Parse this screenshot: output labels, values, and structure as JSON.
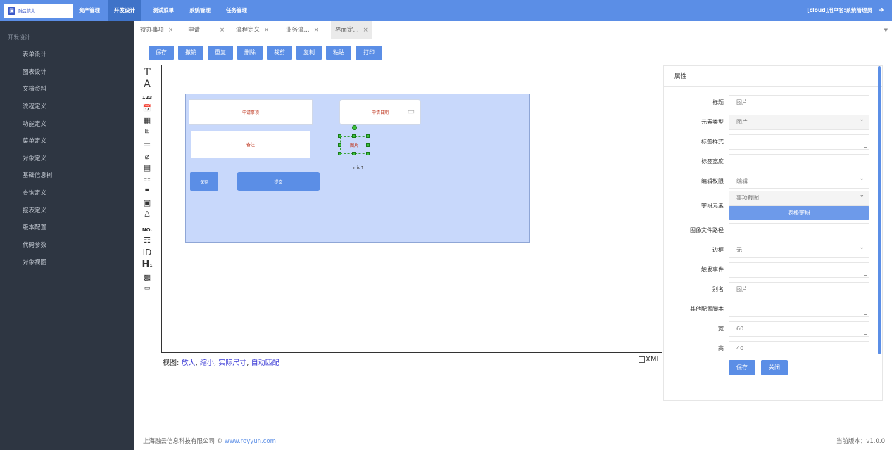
{
  "app": {
    "logo_text": "融云信息",
    "nav": [
      "资产管理",
      "开发设计",
      "测试菜单",
      "系统管理",
      "任务管理"
    ],
    "active_nav": "开发设计",
    "user_info": "[cloud]用户名:系统管理员"
  },
  "sidebar": {
    "section": "开发设计",
    "items": [
      "表单设计",
      "图表设计",
      "文档资料",
      "流程定义",
      "功能定义",
      "菜单定义",
      "对象定义",
      "基础信息树",
      "查询定义",
      "报表定义",
      "版本配置",
      "代码参数",
      "对象视图"
    ]
  },
  "tabs": [
    "待办事项",
    "申请",
    "流程定义",
    "业务流...",
    "界面定..."
  ],
  "toolbar": [
    "保存",
    "撤销",
    "重复",
    "删除",
    "裁剪",
    "复制",
    "粘贴",
    "打印"
  ],
  "palette": [
    "T",
    "A",
    "123",
    "ID",
    "NO."
  ],
  "canvas": {
    "field1": "申请事项",
    "field2": "申请日期",
    "field3": "备注",
    "btn_save": "保存",
    "btn_submit": "提交",
    "selected_image": "图片",
    "selected_name": "div1"
  },
  "viewbar": {
    "prefix": "视图: ",
    "zoom_in": "放大",
    "zoom_out": "缩小",
    "actual": "实际尺寸",
    "fit": "自动匹配",
    "sep": ", ",
    "xml": "XML"
  },
  "properties": {
    "title": "属性",
    "rows": [
      {
        "label": "标题",
        "value": "图片"
      },
      {
        "label": "元素类型",
        "value": "图片"
      },
      {
        "label": "标签样式",
        "value": ""
      },
      {
        "label": "标签宽度",
        "value": ""
      },
      {
        "label": "编辑权限",
        "value": "编辑"
      },
      {
        "label": "字段元素",
        "value": "事项截图"
      },
      {
        "label": "图像文件路径",
        "value": ""
      },
      {
        "label": "边框",
        "value": "无"
      },
      {
        "label": "触发事件",
        "value": ""
      },
      {
        "label": "别名",
        "value": "图片"
      },
      {
        "label": "其他配置脚本",
        "value": ""
      },
      {
        "label": "宽",
        "value": "60"
      },
      {
        "label": "高",
        "value": "40"
      }
    ],
    "table_field_button": "表格字段",
    "save": "保存",
    "close": "关闭"
  },
  "footer": {
    "company": "上海融云信息科技有限公司 © ",
    "url": "www.royyun.com",
    "version": "当前版本：v1.0.0"
  }
}
